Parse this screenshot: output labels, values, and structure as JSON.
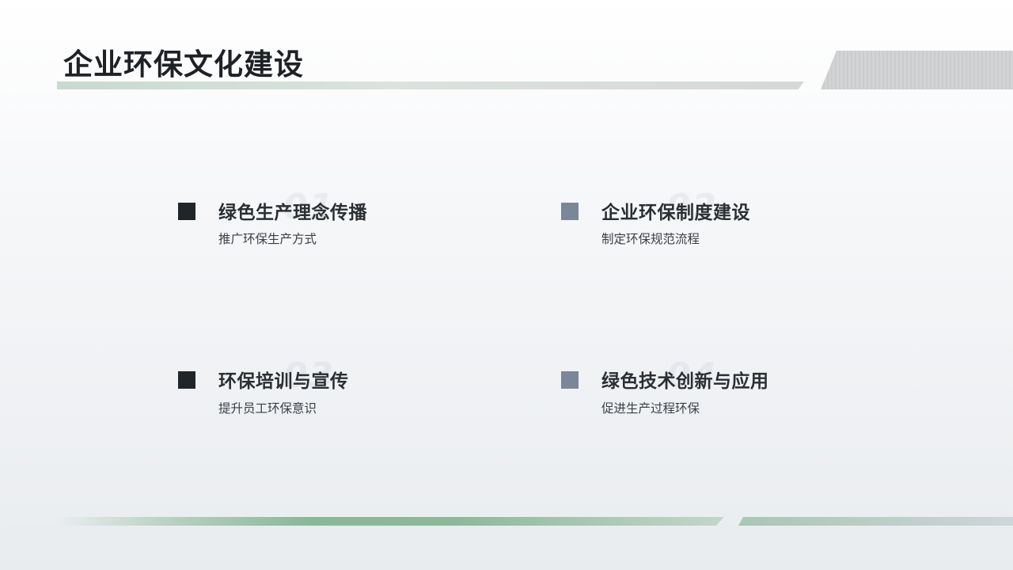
{
  "title": "企业环保文化建设",
  "items": [
    {
      "number": "01",
      "heading": "绿色生产理念传播",
      "description": "推广环保生产方式",
      "marker_color": "#1f2529"
    },
    {
      "number": "02",
      "heading": "企业环保制度建设",
      "description": "制定环保规范流程",
      "marker_color": "#7b8698"
    },
    {
      "number": "03",
      "heading": "环保培训与宣传",
      "description": "提升员工环保意识",
      "marker_color": "#1f2529"
    },
    {
      "number": "04",
      "heading": "绿色技术创新与应用",
      "description": "促进生产过程环保",
      "marker_color": "#7b8698"
    }
  ],
  "colors": {
    "accent_green": "#8db99b",
    "dark_marker": "#1f2529",
    "gray_marker": "#7b8698"
  }
}
